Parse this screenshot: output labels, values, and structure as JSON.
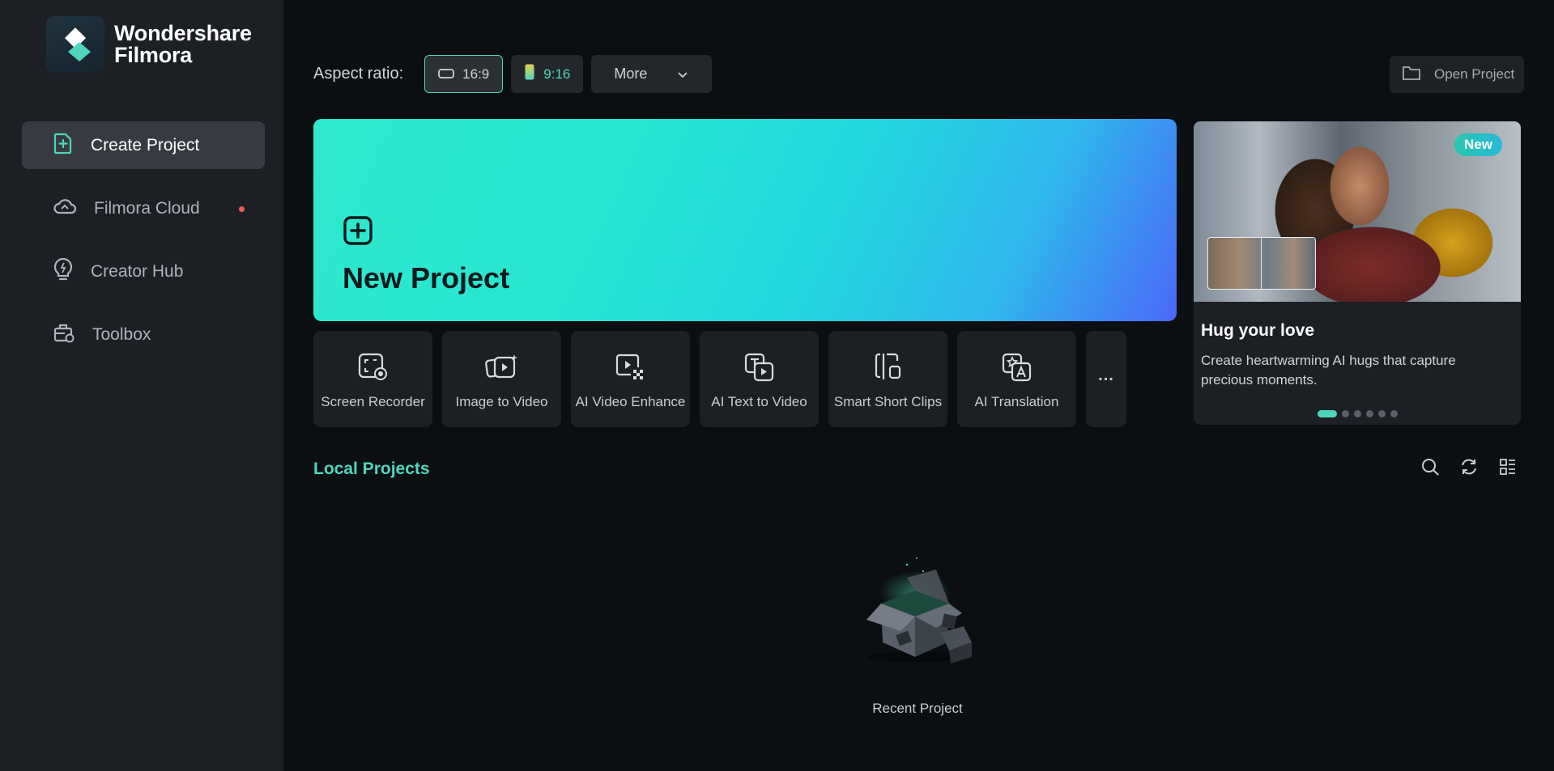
{
  "app": {
    "logo_line1": "Wondershare",
    "logo_line2": "Filmora",
    "accent_color": "#4ed6bd"
  },
  "sidebar": {
    "items": [
      {
        "label": "Create Project",
        "icon": "add-project-icon",
        "active": true
      },
      {
        "label": "Filmora Cloud",
        "icon": "cloud-icon",
        "notification": true
      },
      {
        "label": "Creator Hub",
        "icon": "lightbulb-icon"
      },
      {
        "label": "Toolbox",
        "icon": "toolbox-icon"
      }
    ]
  },
  "toolbar": {
    "aspect_label": "Aspect ratio:",
    "ratio_16_9": "16:9",
    "ratio_9_16": "9:16",
    "more_label": "More",
    "open_project_label": "Open Project"
  },
  "new_project": {
    "title": "New Project"
  },
  "tools": [
    {
      "label": "Screen Recorder",
      "icon": "screen-recorder-icon"
    },
    {
      "label": "Image to Video",
      "icon": "image-to-video-icon"
    },
    {
      "label": "AI Video Enhance",
      "icon": "video-enhance-icon"
    },
    {
      "label": "AI Text to Video",
      "icon": "text-to-video-icon"
    },
    {
      "label": "Smart Short Clips",
      "icon": "short-clips-icon"
    },
    {
      "label": "AI Translation",
      "icon": "translation-icon"
    }
  ],
  "tools_more": "...",
  "promo": {
    "badge": "New",
    "title": "Hug your love",
    "description": "Create heartwarming AI hugs that capture precious moments.",
    "pages": 6,
    "current_page": 1
  },
  "local_projects": {
    "title": "Local Projects",
    "empty_label": "Recent Project"
  }
}
